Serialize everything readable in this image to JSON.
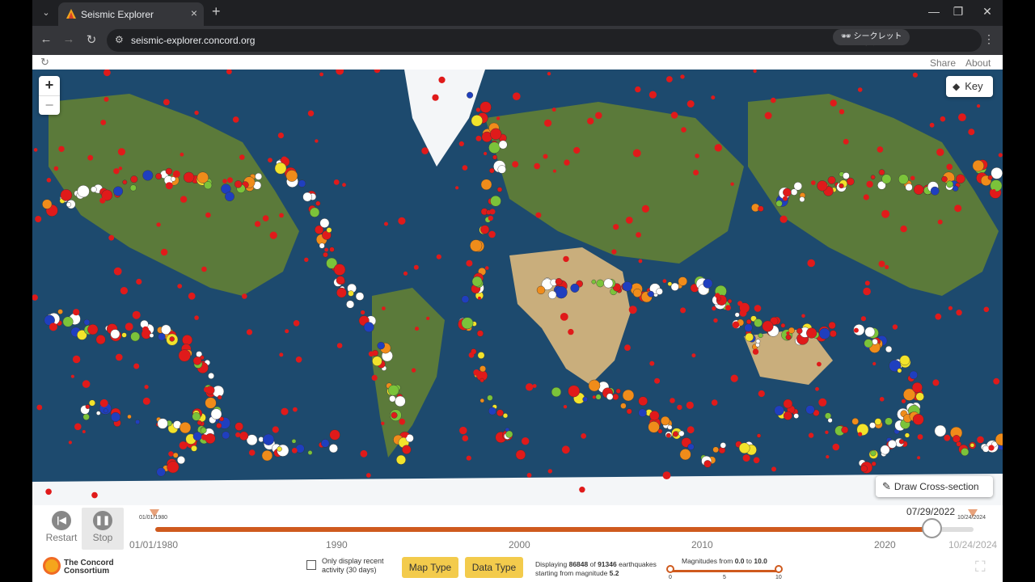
{
  "browser": {
    "tab_title": "Seismic Explorer",
    "url": "seismic-explorer.concord.org",
    "incognito_label": "シークレット"
  },
  "header": {
    "share": "Share",
    "about": "About"
  },
  "map": {
    "zoom_in": "+",
    "zoom_out": "−",
    "key_label": "Key",
    "cross_section_label": "Draw Cross-section",
    "colors": {
      "ocean": "#1d4a6e",
      "land": "#5b7a3a",
      "desert": "#c9ae7c",
      "ice": "#f4f6f8",
      "quake_red": "#e01a1a",
      "quake_white": "#ffffff",
      "quake_orange": "#f08c1a",
      "quake_yellow": "#f2e32b",
      "quake_blue": "#1f3fbf",
      "quake_green": "#7bc33a"
    }
  },
  "controls": {
    "restart_label": "Restart",
    "stop_label": "Stop",
    "current_date": "07/29/2022",
    "start_mini": "01/01/1980",
    "end_mini": "10/24/2024",
    "start_date": "01/01/1980",
    "end_date": "10/24/2024",
    "ticks": [
      "1990",
      "2000",
      "2010",
      "2020"
    ],
    "progress_fraction": 0.954,
    "recent_label": "Only display recent activity (30 days)",
    "map_type": "Map Type",
    "data_type": "Data Type",
    "display_prefix": "Displaying",
    "displayed_count": "86848",
    "display_of": "of",
    "total_count": "91346",
    "display_suffix": "earthquakes starting from magnitude",
    "min_magnitude": "5.2",
    "mag_prefix": "Magnitudes from",
    "mag_from": "0.0",
    "mag_to_word": "to",
    "mag_to": "10.0",
    "mag_ticks": [
      "0",
      "5",
      "10"
    ],
    "logo_line1": "The Concord",
    "logo_line2": "Consortium"
  }
}
